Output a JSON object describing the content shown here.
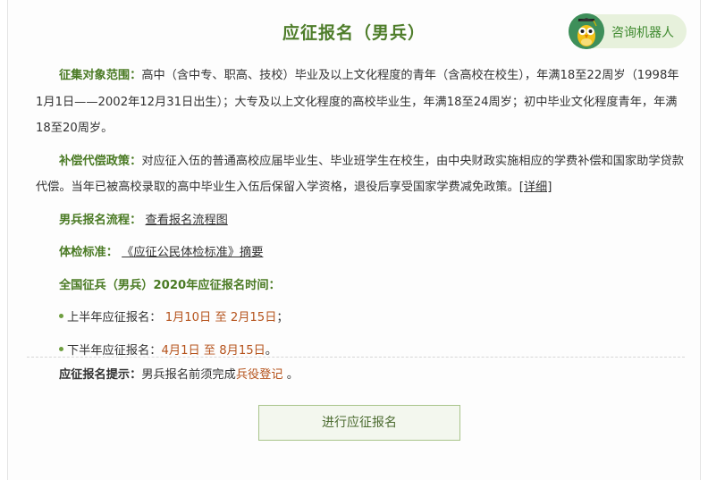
{
  "page": {
    "title": "应征报名（男兵）"
  },
  "robot": {
    "label": "咨询机器人",
    "icon": "owl-robot-icon"
  },
  "colors": {
    "accent_green": "#4a7a24",
    "accent_orange": "#b5531c",
    "button_bg": "#f3f7ee",
    "button_border": "#a9c48b"
  },
  "sections": {
    "target": {
      "label": "征集对象范围：",
      "text": "高中（含中专、职高、技校）毕业及以上文化程度的青年（含高校在校生），年满18至22周岁（1998年1月1日——2002年12月31日出生）；大专及以上文化程度的高校毕业生，年满18至24周岁；初中毕业文化程度青年，年满18至20周岁。"
    },
    "compensation": {
      "label": "补偿代偿政策：",
      "text": "对应征入伍的普通高校应届毕业生、毕业班学生在校生，由中央财政实施相应的学费补偿和国家助学贷款代偿。当年已被高校录取的高中毕业生入伍后保留入学资格，退役后享受国家学费减免政策。",
      "link": "[详细]"
    },
    "process": {
      "label": "男兵报名流程：",
      "link": "查看报名流程图"
    },
    "standard": {
      "label": "体检标准：",
      "link": "《应征公民体检标准》",
      "suffix": "摘要"
    },
    "schedule": {
      "label": "全国征兵（男兵）2020年应征报名时间：",
      "first_half": {
        "label": "上半年应征报名：",
        "start": "1月10日",
        "sep": "至",
        "end": "2月15日",
        "tail": "；"
      },
      "second_half": {
        "label": "下半年应征报名：",
        "start": "4月1日",
        "sep": "至",
        "end": "8月15日",
        "tail": "。"
      }
    }
  },
  "tip": {
    "label": "应征报名提示：",
    "text": "男兵报名前须完成",
    "link": "兵役登记",
    "tail": "。"
  },
  "actions": {
    "apply_label": "进行应征报名"
  }
}
